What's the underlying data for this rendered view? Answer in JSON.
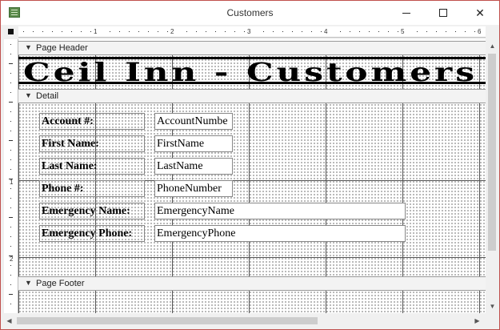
{
  "window": {
    "title": "Customers"
  },
  "ruler": {
    "marks": [
      "1",
      "2",
      "3",
      "4",
      "5",
      "6"
    ],
    "vmarks": [
      "1",
      "2"
    ]
  },
  "sections": {
    "page_header": "Page Header",
    "detail": "Detail",
    "page_footer": "Page Footer"
  },
  "header": {
    "title": "Ceil Inn - Customers"
  },
  "detail_fields": [
    {
      "label": "Account #:",
      "field": "AccountNumbe"
    },
    {
      "label": "First Name:",
      "field": "FirstName"
    },
    {
      "label": "Last Name:",
      "field": "LastName"
    },
    {
      "label": "Phone #:",
      "field": "PhoneNumber"
    },
    {
      "label": "Emergency Name:",
      "field": "EmergencyName"
    },
    {
      "label": "Emergency Phone:",
      "field": "EmergencyPhone"
    }
  ],
  "icons": {
    "app": "access-report-icon",
    "section_toggle": "section-arrow-icon"
  }
}
